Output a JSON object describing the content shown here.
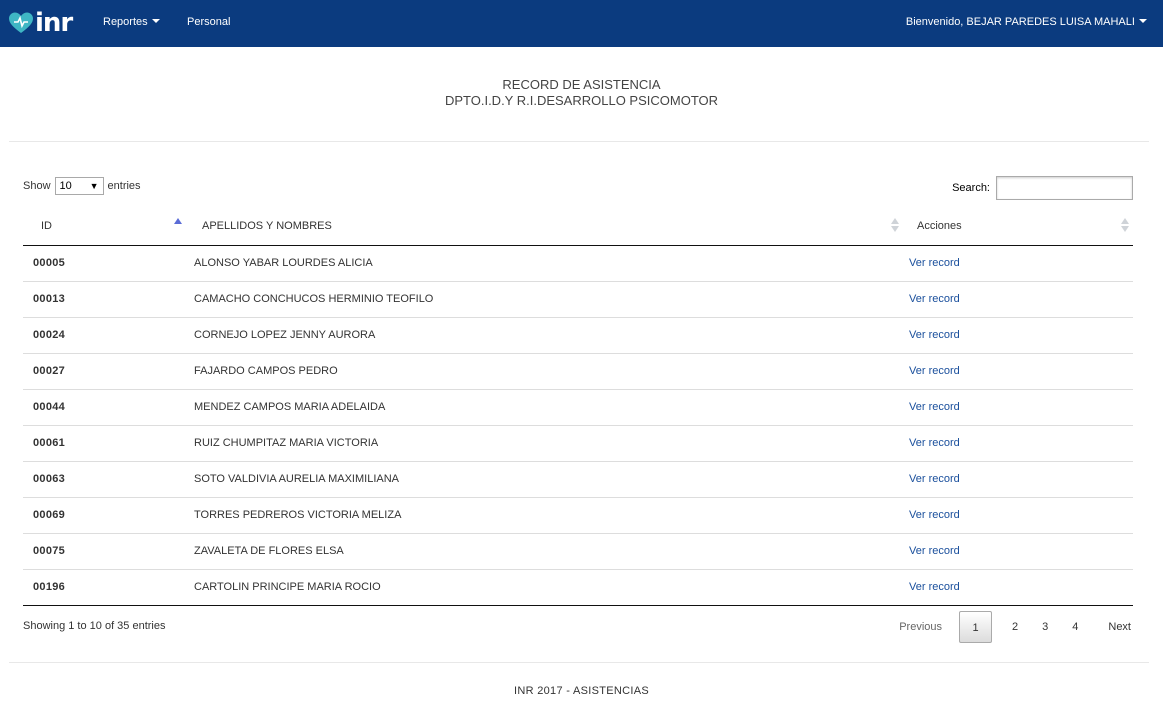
{
  "nav": {
    "brand": "inr",
    "reportes": "Reportes",
    "personal": "Personal",
    "user": "Bienvenido, BEJAR PAREDES LUISA MAHALI"
  },
  "header": {
    "title_line1": "RECORD DE ASISTENCIA",
    "title_line2": "DPTO.I.D.Y R.I.DESARROLLO PSICOMOTOR"
  },
  "controls": {
    "show_label": "Show",
    "entries_value": "10",
    "entries_label": "entries",
    "search_label": "Search:",
    "search_value": ""
  },
  "table": {
    "columns": [
      "ID",
      "APELLIDOS Y NOMBRES",
      "Acciones"
    ],
    "rows": [
      {
        "id": "00005",
        "name": "ALONSO YABAR LOURDES ALICIA",
        "action": "Ver record"
      },
      {
        "id": "00013",
        "name": "CAMACHO CONCHUCOS HERMINIO TEOFILO",
        "action": "Ver record"
      },
      {
        "id": "00024",
        "name": "CORNEJO LOPEZ JENNY AURORA",
        "action": "Ver record"
      },
      {
        "id": "00027",
        "name": "FAJARDO CAMPOS PEDRO",
        "action": "Ver record"
      },
      {
        "id": "00044",
        "name": "MENDEZ CAMPOS MARIA ADELAIDA",
        "action": "Ver record"
      },
      {
        "id": "00061",
        "name": "RUIZ CHUMPITAZ MARIA VICTORIA",
        "action": "Ver record"
      },
      {
        "id": "00063",
        "name": "SOTO VALDIVIA AURELIA MAXIMILIANA",
        "action": "Ver record"
      },
      {
        "id": "00069",
        "name": "TORRES PEDREROS VICTORIA MELIZA",
        "action": "Ver record"
      },
      {
        "id": "00075",
        "name": "ZAVALETA DE FLORES ELSA",
        "action": "Ver record"
      },
      {
        "id": "00196",
        "name": "CARTOLIN PRINCIPE MARIA ROCIO",
        "action": "Ver record"
      }
    ]
  },
  "info": "Showing 1 to 10 of 35 entries",
  "pagination": {
    "previous": "Previous",
    "pages": [
      "1",
      "2",
      "3",
      "4"
    ],
    "next": "Next"
  },
  "footer": "INR 2017 - ASISTENCIAS",
  "colors": {
    "navbar": "#0b3b7f",
    "link": "#1a4f9c",
    "logo_accent": "#3fb6c4"
  }
}
